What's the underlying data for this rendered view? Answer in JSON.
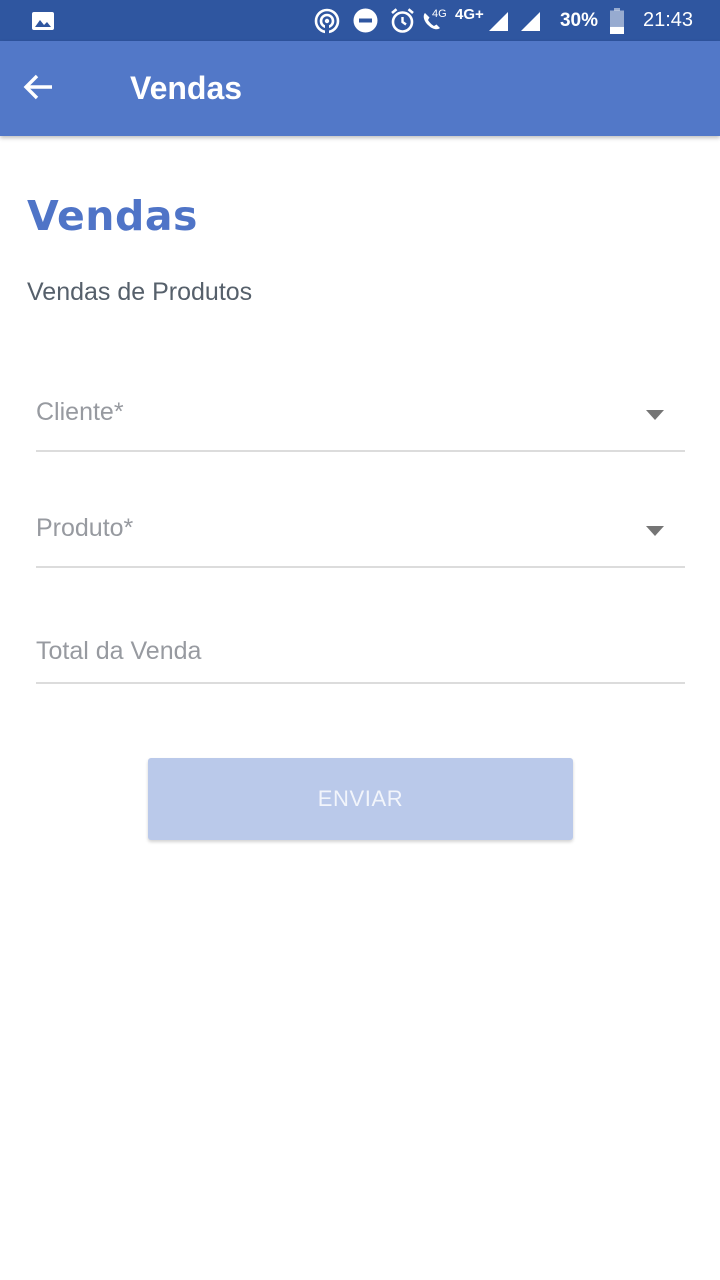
{
  "status_bar": {
    "network_label": "4G",
    "network_type": "4G+",
    "battery_percent": "30%",
    "time": "21:43",
    "battery_level": 0.3,
    "icons": [
      "image-icon",
      "hotspot-icon",
      "do-not-disturb-icon",
      "alarm-icon",
      "volte-call-icon",
      "signal-icon",
      "signal-icon",
      "battery-icon"
    ]
  },
  "app_bar": {
    "back_icon": "arrow-back-icon",
    "title": "Vendas"
  },
  "main": {
    "title": "Vendas",
    "subtitle": "Vendas de Produtos",
    "fields": {
      "cliente": {
        "label": "Cliente*",
        "icon": "chevron-down-icon"
      },
      "produto": {
        "label": "Produto*",
        "icon": "chevron-down-icon"
      },
      "total": {
        "label": "Total da Venda"
      }
    },
    "submit_label": "ENVIAR"
  },
  "colors": {
    "status_bar": "#2f56a0",
    "app_bar": "#5278c8",
    "accent": "#4f74c7",
    "button_disabled": "#bac9ea"
  }
}
